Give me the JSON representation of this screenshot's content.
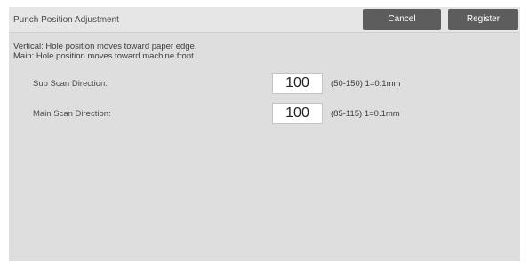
{
  "header": {
    "title": "Punch Position Adjustment",
    "cancel_label": "Cancel",
    "register_label": "Register"
  },
  "description": {
    "line1": "Vertical: Hole position moves toward paper edge.",
    "line2": "Main: Hole position moves toward machine front."
  },
  "settings": [
    {
      "label": "Sub Scan Direction:",
      "value": "100",
      "range": "(50-150) 1=0.1mm"
    },
    {
      "label": "Main Scan Direction:",
      "value": "100",
      "range": "(85-115) 1=0.1mm"
    }
  ],
  "colors": {
    "button_bg": "#5d5d5d",
    "screen_bg": "#dedede"
  }
}
